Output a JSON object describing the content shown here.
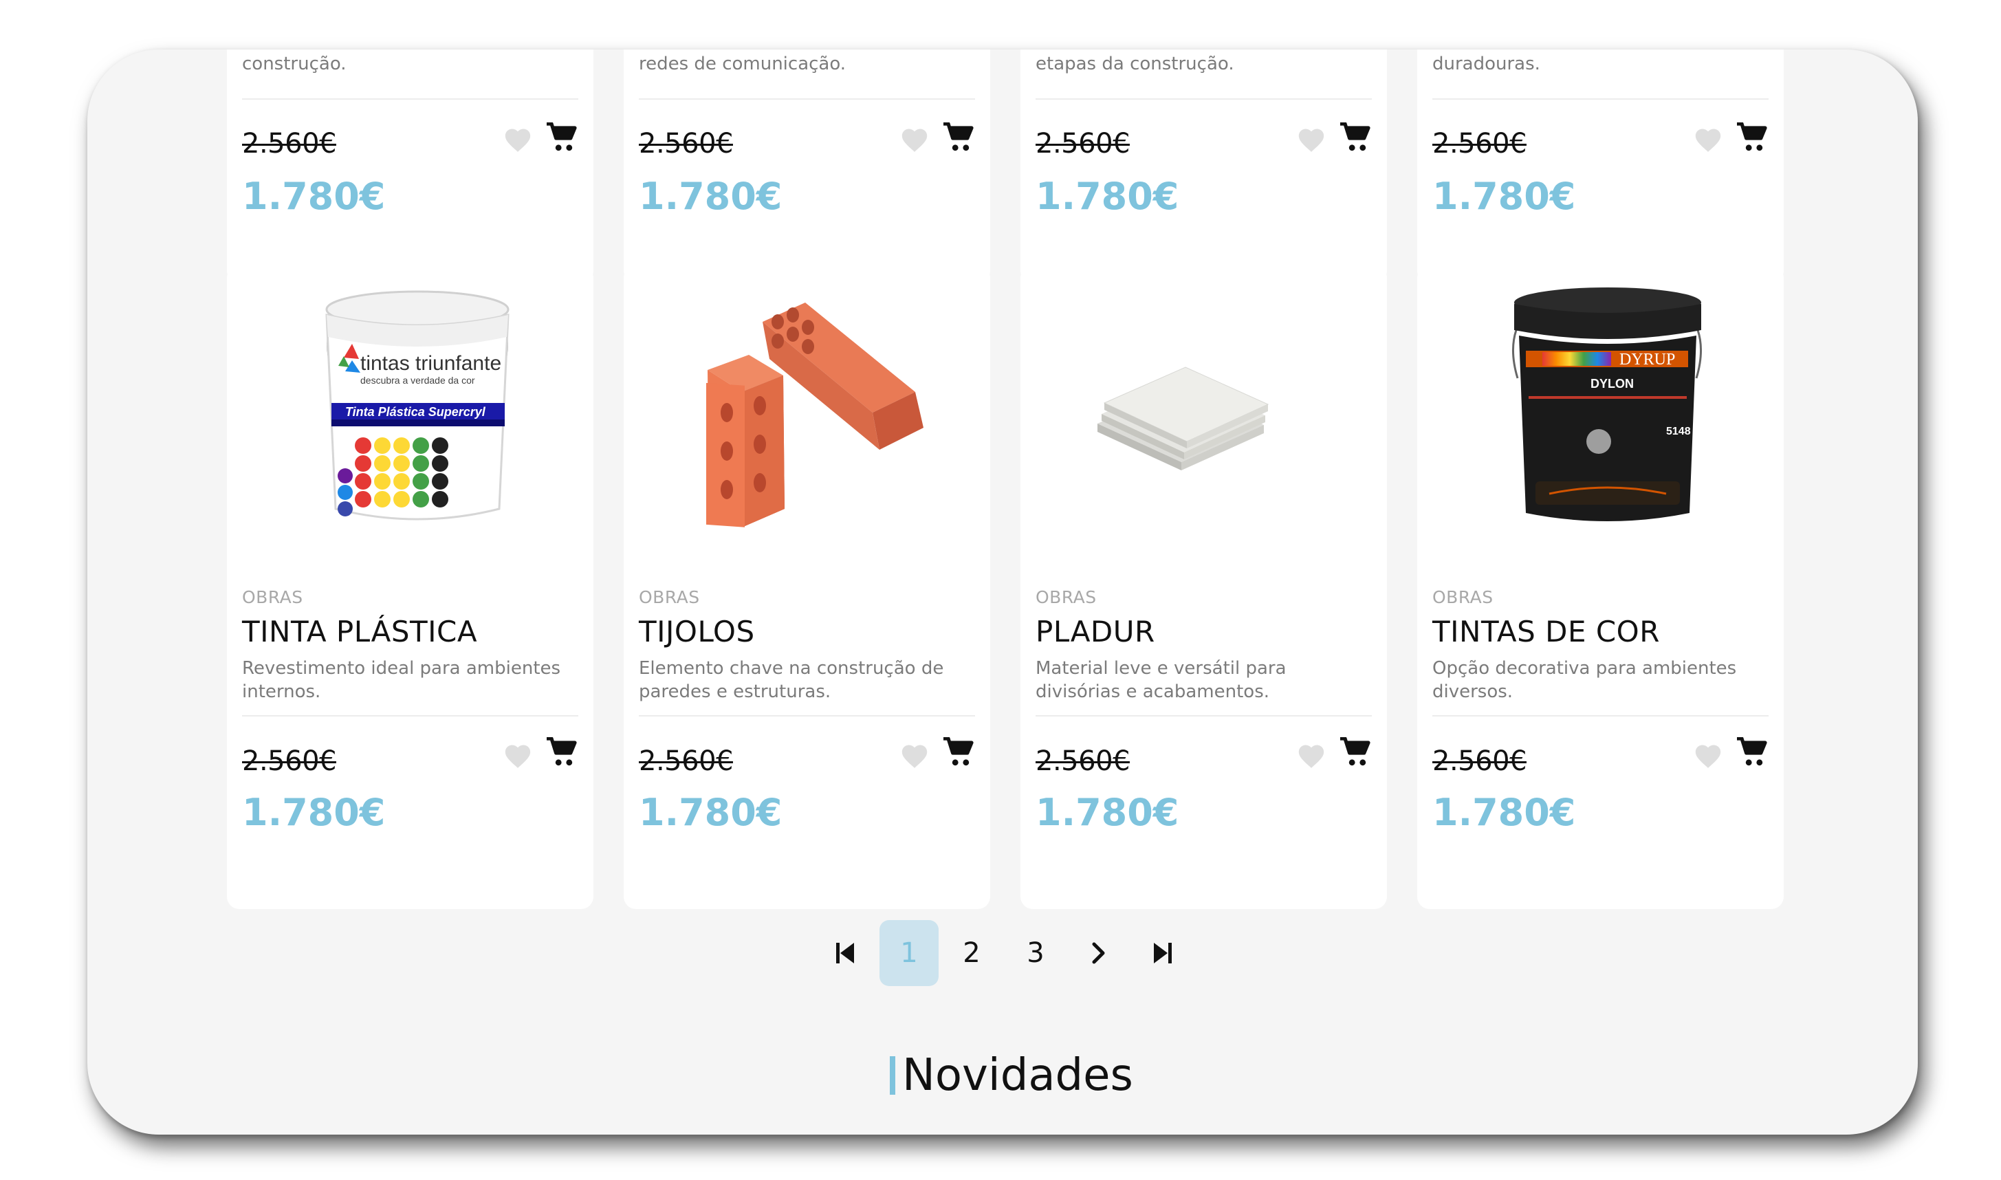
{
  "top_row": [
    {
      "desc": "construção.",
      "old_price": "2.560€",
      "new_price": "1.780€"
    },
    {
      "desc": "redes de comunicação.",
      "old_price": "2.560€",
      "new_price": "1.780€"
    },
    {
      "desc": "etapas da construção.",
      "old_price": "2.560€",
      "new_price": "1.780€"
    },
    {
      "desc": "duradouras.",
      "old_price": "2.560€",
      "new_price": "1.780€"
    }
  ],
  "products": [
    {
      "category": "OBRAS",
      "name": "TINTA PLÁSTICA",
      "desc": "Revestimento ideal para ambientes internos.",
      "old_price": "2.560€",
      "new_price": "1.780€",
      "image": "paint-bucket-white",
      "label_brand": "tintas triunfante",
      "label_tagline": "descubra a verdade da cor",
      "label_band": "Tinta Plástica Supercryl"
    },
    {
      "category": "OBRAS",
      "name": "TIJOLOS",
      "desc": "Elemento chave na construção de paredes e estruturas.",
      "old_price": "2.560€",
      "new_price": "1.780€",
      "image": "bricks"
    },
    {
      "category": "OBRAS",
      "name": "PLADUR",
      "desc": "Material leve e versátil para divisórias e acabamentos.",
      "old_price": "2.560€",
      "new_price": "1.780€",
      "image": "plasterboard"
    },
    {
      "category": "OBRAS",
      "name": "TINTAS DE COR",
      "desc": "Opção decorativa para ambientes diversos.",
      "old_price": "2.560€",
      "new_price": "1.780€",
      "image": "paint-bucket-black",
      "label_brand": "DYRUP",
      "label_product": "DYLON",
      "label_code": "5148"
    }
  ],
  "pagination": {
    "first_icon": "first-page-icon",
    "pages": [
      "1",
      "2",
      "3"
    ],
    "active_page": "1",
    "next_icon": "chevron-right-icon",
    "last_icon": "last-page-icon"
  },
  "section": {
    "title": "Novidades"
  },
  "colors": {
    "accent": "#7ec3dd",
    "active_page_bg": "#cce3ee",
    "background": "#f5f5f5",
    "card": "#ffffff"
  }
}
